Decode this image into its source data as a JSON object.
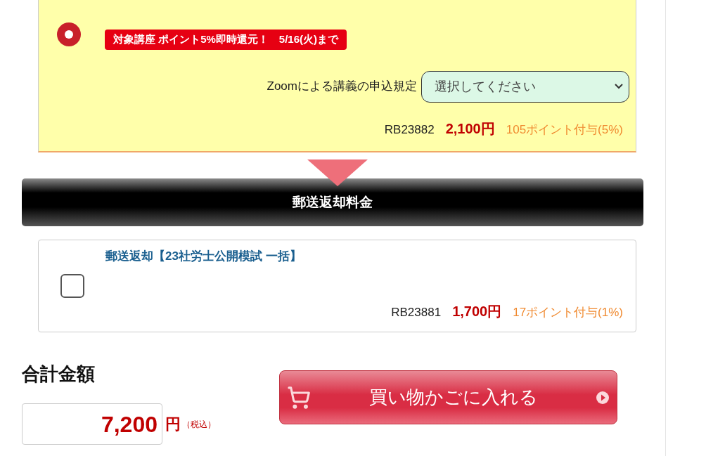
{
  "offer_item": {
    "selected": true,
    "promo_badge": "対象講座 ポイント5%即時還元！　5/16(火)まで",
    "select_label": "Zoomによる講義の申込規定",
    "select": {
      "placeholder": "選択してください"
    },
    "code": "RB23882",
    "price": "2,100円",
    "points": "105ポイント付与(5%)"
  },
  "section_header": "郵送返却料金",
  "return_item": {
    "checked": false,
    "title": "郵送返却【23社労士公開模試 一括】",
    "code": "RB23881",
    "price": "1,700円",
    "points": "17ポイント付与(1%)"
  },
  "total": {
    "label": "合計金額",
    "amount": "7,200",
    "unit": "円",
    "tax_note": "（税込）"
  },
  "cart_button": "買い物かごに入れる"
}
